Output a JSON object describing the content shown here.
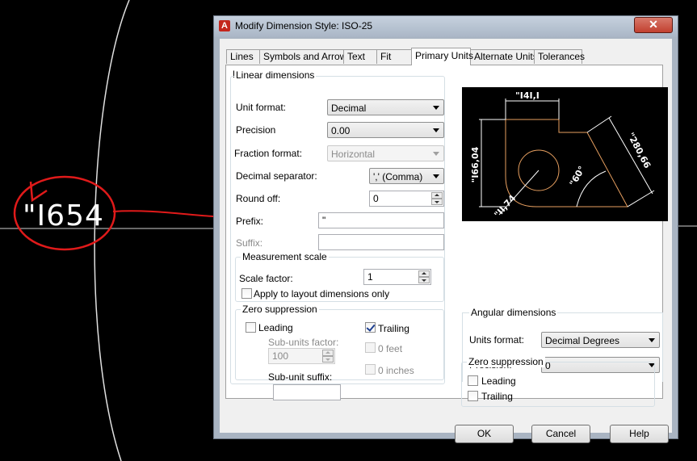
{
  "background": {
    "dimension_text": "\"I654"
  },
  "dialog": {
    "title": "Modify Dimension Style: ISO-25",
    "app_icon_glyph": "A",
    "close_glyph": "✕",
    "tabs": [
      {
        "label": "Lines",
        "active": false
      },
      {
        "label": "Symbols and Arrows",
        "active": false
      },
      {
        "label": "Text",
        "active": false
      },
      {
        "label": "Fit",
        "active": false
      },
      {
        "label": "Primary Units",
        "active": true
      },
      {
        "label": "Alternate Units",
        "active": false
      },
      {
        "label": "Tolerances",
        "active": false
      }
    ],
    "linear": {
      "group_title": "Linear dimensions",
      "unit_format_label": "Unit format:",
      "unit_format_value": "Decimal",
      "precision_label": "Precision",
      "precision_value": "0.00",
      "fraction_format_label": "Fraction format:",
      "fraction_format_value": "Horizontal",
      "decimal_separator_label": "Decimal separator:",
      "decimal_separator_value": "',' (Comma)",
      "round_off_label": "Round off:",
      "round_off_value": "0",
      "prefix_label": "Prefix:",
      "prefix_value": "\"",
      "suffix_label": "Suffix:",
      "suffix_value": ""
    },
    "measurement_scale": {
      "group_title": "Measurement scale",
      "scale_factor_label": "Scale factor:",
      "scale_factor_value": "1",
      "apply_layout_label": "Apply to layout dimensions only",
      "apply_layout_checked": false
    },
    "zero_suppression": {
      "group_title": "Zero suppression",
      "leading_label": "Leading",
      "leading_checked": false,
      "trailing_label": "Trailing",
      "trailing_checked": true,
      "sub_units_factor_label": "Sub-units factor:",
      "sub_units_factor_value": "100",
      "sub_unit_suffix_label": "Sub-unit suffix:",
      "sub_unit_suffix_value": "",
      "zero_feet_label": "0 feet",
      "zero_inches_label": "0 inches"
    },
    "preview": {
      "dim_top": "\"I4I,I",
      "dim_left": "\"I66,04",
      "dim_right": "\"280,66",
      "dim_angle": "\"60°",
      "dim_radius": "\"II,74"
    },
    "angular": {
      "group_title": "Angular dimensions",
      "units_format_label": "Units format:",
      "units_format_value": "Decimal Degrees",
      "precision_label": "Precision:",
      "precision_value": "0",
      "zero_group_title": "Zero suppression",
      "leading_label": "Leading",
      "leading_checked": false,
      "trailing_label": "Trailing",
      "trailing_checked": false
    },
    "buttons": {
      "ok": "OK",
      "cancel": "Cancel",
      "help": "Help"
    }
  },
  "colors": {
    "annotation_red": "#e01a1a",
    "preview_line": "#e8a060",
    "title_bar": "#aab6c6"
  }
}
